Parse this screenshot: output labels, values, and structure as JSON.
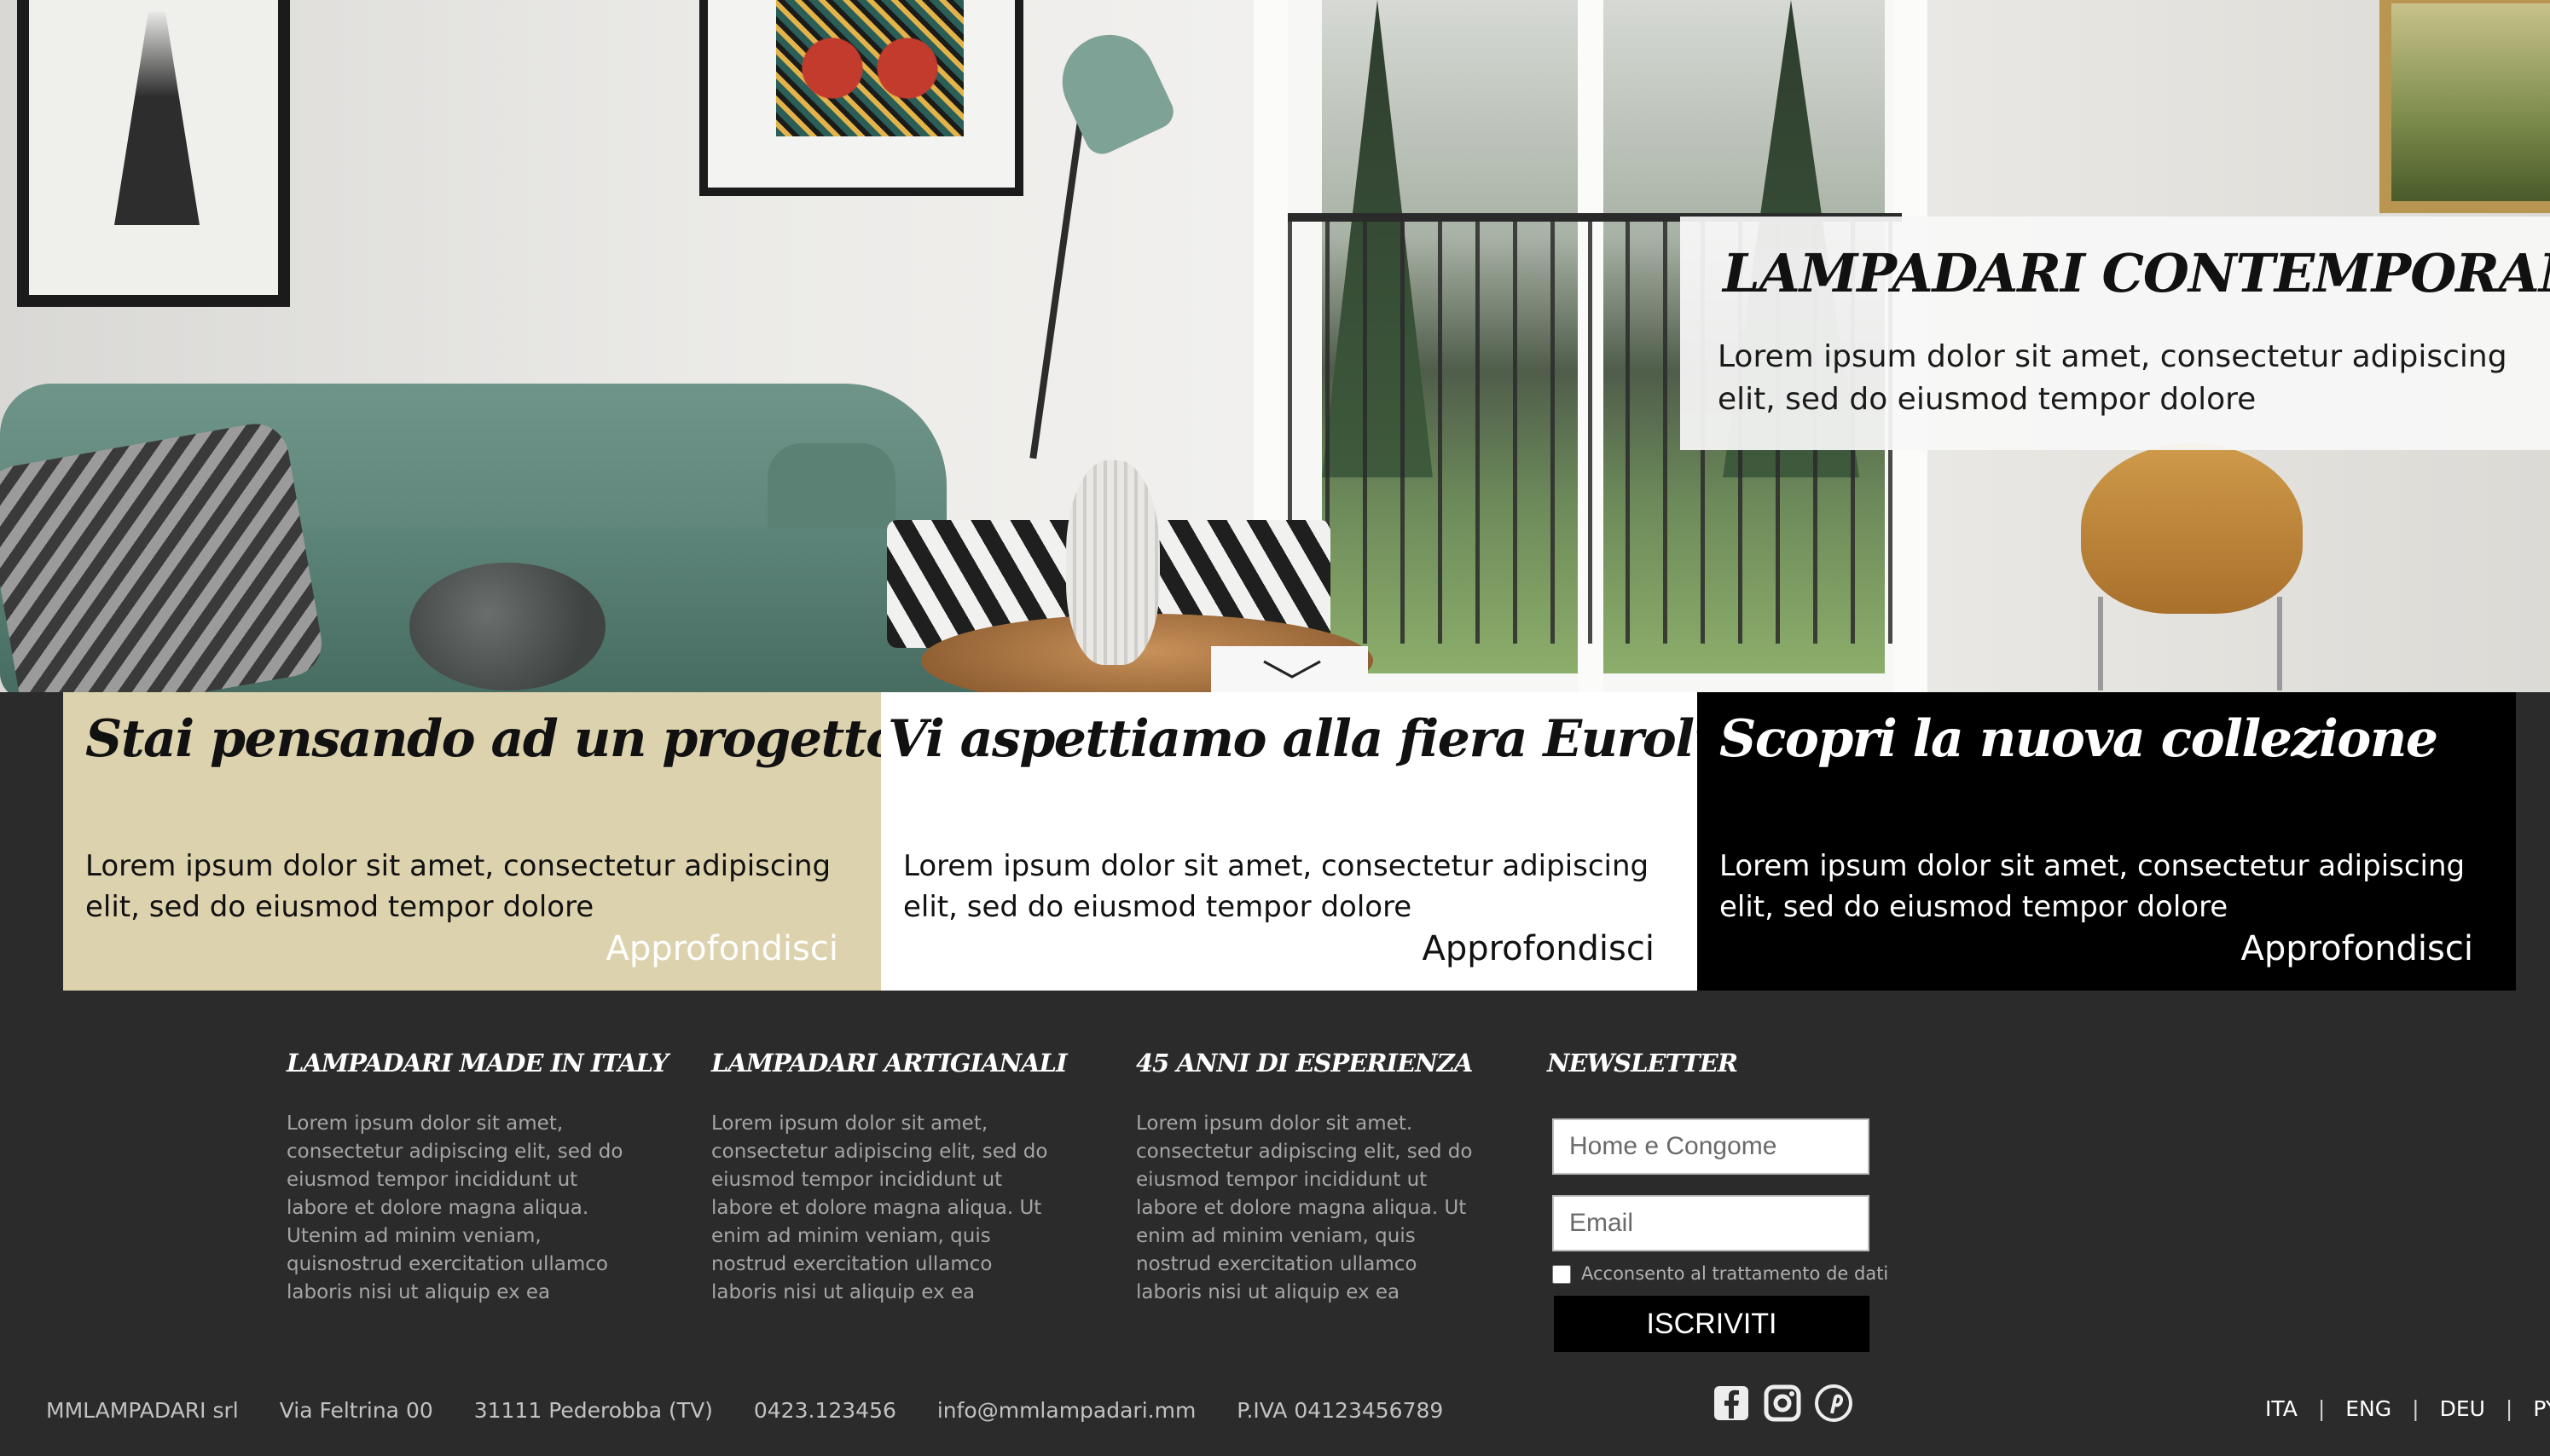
{
  "hero": {
    "title": "LAMPADARI CONTEMPORANEI",
    "text": "Lorem ipsum dolor sit amet, consectetur adipiscing elit, sed do eiusmod tempor dolore"
  },
  "cards": [
    {
      "title": "Stai pensando ad un progetto?",
      "text": "Lorem ipsum dolor sit amet, consectetur adipiscing elit, sed do eiusmod tempor dolore",
      "link": "Approfondisci",
      "bg": "#ddd2ae"
    },
    {
      "title": "Vi aspettiamo alla fiera Euroluce",
      "text": "Lorem ipsum dolor sit amet, consectetur adipiscing elit, sed do eiusmod tempor dolore",
      "link": "Approfondisci",
      "bg": "#ffffff"
    },
    {
      "title": "Scopri la nuova collezione",
      "text": "Lorem ipsum dolor sit amet, consectetur adipiscing elit, sed do eiusmod tempor dolore",
      "link": "Approfondisci",
      "bg": "#000000"
    }
  ],
  "footer": {
    "columns": [
      {
        "title": "LAMPADARI MADE IN ITALY",
        "text": "Lorem ipsum dolor sit amet, consectetur adipiscing elit, sed do eiusmod tempor incididunt ut labore et dolore magna aliqua. Utenim ad minim veniam, quisnostrud exercitation ullamco laboris nisi ut aliquip ex ea"
      },
      {
        "title": "LAMPADARI ARTIGIANALI",
        "text": "Lorem ipsum dolor sit amet, consectetur adipiscing elit, sed do eiusmod tempor incididunt ut labore et dolore magna aliqua. Ut enim ad minim veniam, quis nostrud exercitation ullamco laboris nisi ut aliquip ex ea"
      },
      {
        "title": "45 ANNI DI ESPERIENZA",
        "text": "Lorem ipsum dolor sit amet. consectetur adipiscing elit, sed do eiusmod tempor incididunt ut labore et dolore magna aliqua. Ut enim ad minim veniam, quis nostrud exercitation ullamco laboris nisi ut aliquip ex ea"
      }
    ],
    "newsletter": {
      "title": "NEWSLETTER",
      "name_placeholder": "Home e Congome",
      "email_placeholder": "Email",
      "consent": "Acconsento al trattamento de dati",
      "button": "ISCRIVITI"
    },
    "info": {
      "company": "MMLAMPADARI srl",
      "street": "Via Feltrina 00",
      "city": "31111 Pederobba (TV)",
      "phone": "0423.123456",
      "email": "info@mmlampadari.mm",
      "vat": "P.IVA 04123456789"
    },
    "social_icons": [
      "facebook-icon",
      "instagram-icon",
      "pinterest-icon"
    ],
    "languages": [
      "ITA",
      "ENG",
      "DEU",
      "PYC"
    ]
  }
}
